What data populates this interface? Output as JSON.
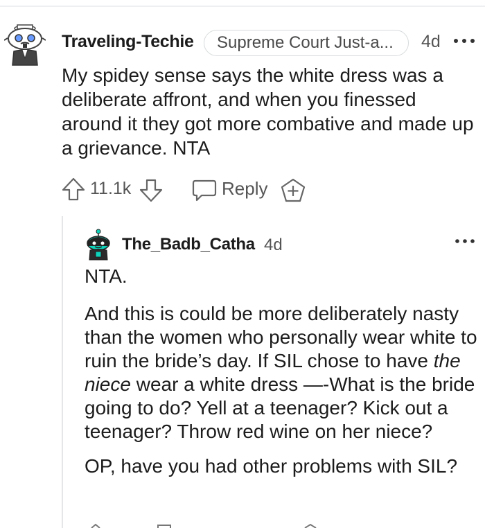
{
  "comment": {
    "username": "Traveling-Techie",
    "flair": "Supreme Court Just-a...",
    "age": "4d",
    "body": "My spidey sense says the white dress was a deliberate affront, and when you finessed around it they got more combative and made up a grievance. NTA",
    "votes": "11.1k",
    "reply_label": "Reply"
  },
  "reply": {
    "username": "The_Badb_Catha",
    "age": "4d",
    "p1": "NTA.",
    "p2_a": "And this is could be more deliberately nasty than the women who personally wear white to ruin the bride’s day. If SIL chose to have ",
    "p2_em": "the niece",
    "p2_b": " wear a white dress —-What is the bride going to do? Yell at a teenager? Kick out a teenager? Throw red wine on her niece?",
    "p3": "OP, have you had other problems with SIL?"
  },
  "icons": {
    "upvote": "arrow-up-icon",
    "downvote": "arrow-down-icon",
    "reply": "speech-bubble-icon",
    "award": "award-plus-icon",
    "more": "ellipsis-icon"
  },
  "colors": {
    "text": "#1c1c1c",
    "meta": "#555555",
    "border": "#d7dadc",
    "thread_line": "#e4e6e8",
    "avatar_teal": "#0dd3bb"
  }
}
